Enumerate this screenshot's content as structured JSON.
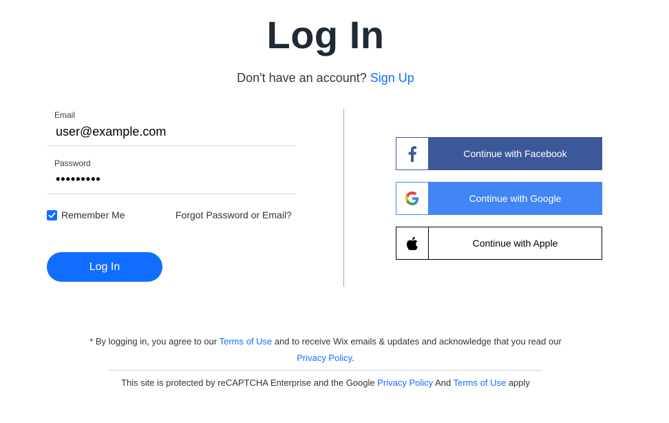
{
  "header": {
    "title": "Log In",
    "no_account_text": "Don't have an account?",
    "signup_link": "Sign Up"
  },
  "form": {
    "email_label": "Email",
    "email_value": "user@example.com",
    "password_label": "Password",
    "password_masked": "•••••••••",
    "remember_label": "Remember Me",
    "remember_checked": true,
    "forgot_link": "Forgot Password or Email?",
    "login_button": "Log In"
  },
  "social": {
    "facebook": {
      "label": "Continue with Facebook",
      "icon": "facebook-icon",
      "color": "#3b5998"
    },
    "google": {
      "label": "Continue with Google",
      "icon": "google-icon",
      "color": "#4285f4"
    },
    "apple": {
      "label": "Continue with Apple",
      "icon": "apple-icon",
      "color": "#000000"
    }
  },
  "footer": {
    "terms_prefix": "* By logging in, you agree to our",
    "terms_link": "Terms of Use",
    "terms_middle": "and to receive Wix emails & updates and acknowledge that you read our",
    "privacy_link": "Privacy Policy",
    "terms_suffix": ".",
    "recaptcha_prefix": "This site is protected by reCAPTCHA Enterprise and the Google",
    "recaptcha_privacy_link": "Privacy Policy",
    "recaptcha_and": "And",
    "recaptcha_terms_link": "Terms of Use",
    "recaptcha_suffix": "apply"
  },
  "colors": {
    "accent": "#116dff",
    "title": "#1f2a36"
  }
}
